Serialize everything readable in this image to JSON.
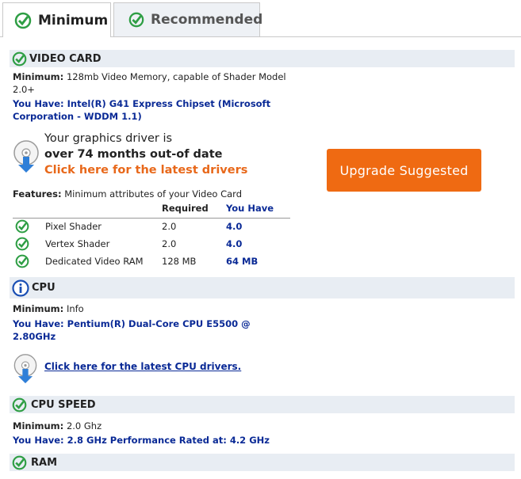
{
  "tabs": [
    {
      "label": "Minimum",
      "active": true
    },
    {
      "label": "Recommended",
      "active": false
    }
  ],
  "video_card": {
    "title": "VIDEO CARD",
    "minimum_label": "Minimum:",
    "minimum_text_line1": "128mb Video Memory, capable of Shader Model",
    "minimum_text_line2": "2.0+",
    "you_have_line1": "You Have: Intel(R) G41 Express Chipset (Microsoft",
    "you_have_line2": "Corporation - WDDM 1.1)",
    "driver_line1": "Your graphics driver is",
    "driver_line2": "over 74 months out-of date",
    "driver_link": "Click here for the latest drivers",
    "upgrade_button": "Upgrade Suggested",
    "features_label": "Features:",
    "features_text": "Minimum attributes of your Video Card",
    "table_headers": {
      "required": "Required",
      "you_have": "You Have"
    },
    "features": [
      {
        "name": "Pixel Shader",
        "required": "2.0",
        "you_have": "4.0"
      },
      {
        "name": "Vertex Shader",
        "required": "2.0",
        "you_have": "4.0"
      },
      {
        "name": "Dedicated Video RAM",
        "required": "128 MB",
        "you_have": "64 MB"
      }
    ]
  },
  "cpu": {
    "title": "CPU",
    "minimum_label": "Minimum:",
    "minimum_text": "Info",
    "you_have_line1": "You Have: Pentium(R) Dual-Core CPU E5500 @",
    "you_have_line2": "2.80GHz",
    "driver_link": "Click here for the latest CPU drivers."
  },
  "cpu_speed": {
    "title": "CPU SPEED",
    "minimum_label": "Minimum:",
    "minimum_text": "2.0 Ghz",
    "you_have": "You Have: 2.8 GHz Performance Rated at: 4.2 GHz"
  },
  "ram": {
    "title": "RAM"
  },
  "colors": {
    "pass_green": "#2e9e44",
    "info_blue": "#1a4fb4",
    "accent_orange": "#ef6a12",
    "link_blue": "#0a2a96",
    "section_bg": "#e8edf3"
  }
}
